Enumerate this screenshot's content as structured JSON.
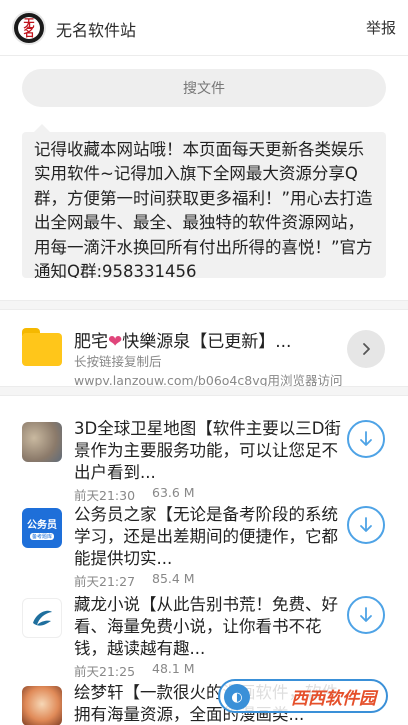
{
  "header": {
    "logo_text": "无名",
    "site_title": "无名软件站",
    "report_label": "举报"
  },
  "search": {
    "label": "搜文件"
  },
  "notice": {
    "text": "记得收藏本网站哦！本页面每天更新各类娱乐实用软件~记得加入旗下全网最大资源分享Q群，方便第一时间获取更多福利！”用心去打造出全网最牛、最全、最独特的软件资源网站，用每一滴汗水换回所有付出所得的喜悦！”官方通知Q群:958331456"
  },
  "share_link": {
    "title_prefix": "肥宅",
    "title_suffix": "快樂源泉【已更新】...",
    "hint": "长按链接复制后",
    "url": "wwpv.lanzouw.com/b06o4c8vg用浏览器访问"
  },
  "files": [
    {
      "title": "3D全球卫星地图【软件主要以三D街景作为主要服务功能，可以让您足不出户看到...",
      "time": "前天21:30",
      "size": "63.6 M",
      "icon": "satellite-map-thumbnail"
    },
    {
      "title": "公务员之家【无论是备考阶段的系统学习，还是出差期间的便捷作，它都能提供切实...",
      "time": "前天21:27",
      "size": "85.4 M",
      "icon": "civil-servant-app-icon",
      "icon_text": "公务员",
      "icon_subtext": "备考题库"
    },
    {
      "title": "藏龙小说【从此告别书荒！免费、好看、海量免费小说，让你看书不花钱，越读越有趣...",
      "time": "前天21:25",
      "size": "48.1 M",
      "icon": "novel-app-icon"
    },
    {
      "title": "绘梦轩【一款很火的漫画软件，软件拥有海量资源，全面的漫画类...",
      "icon": "comic-app-icon"
    }
  ],
  "watermark": {
    "text": "西西软件园"
  },
  "colors": {
    "accent_blue": "#4ea3e6",
    "folder_yellow": "#ffc61a",
    "heart_pink": "#e0457b",
    "notice_bg": "#f1f1f1",
    "search_bg": "#eeeeee"
  }
}
